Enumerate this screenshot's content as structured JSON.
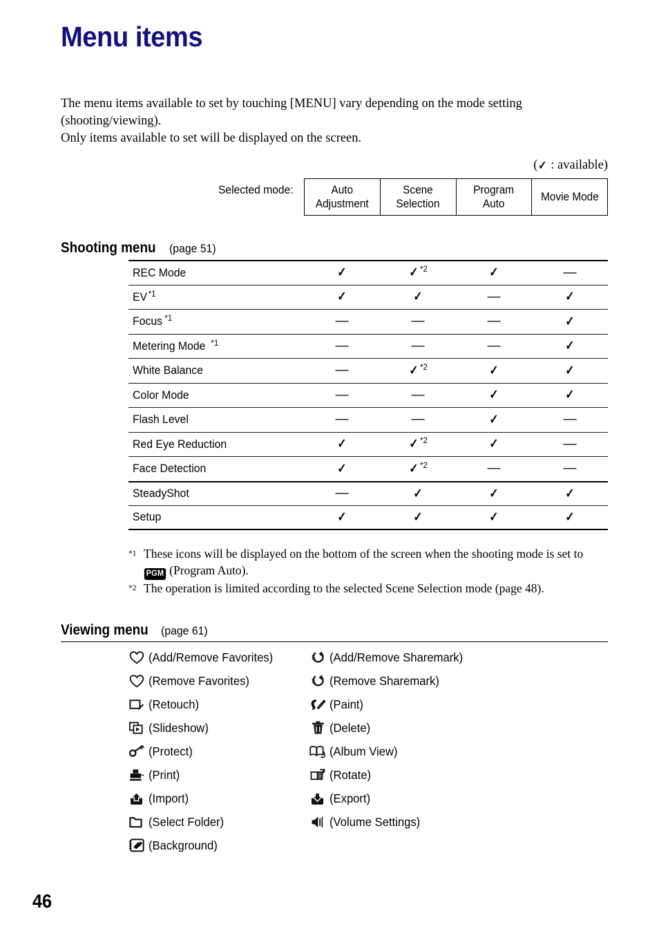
{
  "page": {
    "title": "Menu items",
    "title_color": "#11117f",
    "number": "46"
  },
  "intro": {
    "line1": "The menu items available to set by touching [MENU] vary depending on the mode setting (shooting/viewing).",
    "line2": "Only items available to set will be displayed on the screen."
  },
  "legend": {
    "open": "(",
    "check": "✓",
    "text": ": available)"
  },
  "mode_header": {
    "label": "Selected mode:",
    "columns": [
      "Auto\nAdjustment",
      "Scene\nSelection",
      "Program\nAuto",
      "Movie Mode"
    ]
  },
  "shooting_menu": {
    "heading": "Shooting menu",
    "page_ref": "(page 51)",
    "rows": [
      {
        "name": "REC Mode",
        "sup": "",
        "cells": [
          {
            "type": "check",
            "note": ""
          },
          {
            "type": "check",
            "note": "*2"
          },
          {
            "type": "check",
            "note": ""
          },
          {
            "type": "dash",
            "note": ""
          }
        ]
      },
      {
        "name": "EV",
        "sup": "*1",
        "cells": [
          {
            "type": "check",
            "note": ""
          },
          {
            "type": "check",
            "note": ""
          },
          {
            "type": "dash",
            "note": ""
          },
          {
            "type": "check",
            "note": ""
          }
        ]
      },
      {
        "name": "Focus",
        "sup": "*1",
        "cells": [
          {
            "type": "dash",
            "note": ""
          },
          {
            "type": "dash",
            "note": ""
          },
          {
            "type": "dash",
            "note": ""
          },
          {
            "type": "check",
            "note": ""
          }
        ]
      },
      {
        "name": "Metering Mode",
        "sup": "*1",
        "cells": [
          {
            "type": "dash",
            "note": ""
          },
          {
            "type": "dash",
            "note": ""
          },
          {
            "type": "dash",
            "note": ""
          },
          {
            "type": "check",
            "note": ""
          }
        ]
      },
      {
        "name": "White Balance",
        "sup": "",
        "cells": [
          {
            "type": "dash",
            "note": ""
          },
          {
            "type": "check",
            "note": "*2"
          },
          {
            "type": "check",
            "note": ""
          },
          {
            "type": "check",
            "note": ""
          }
        ]
      },
      {
        "name": "Color Mode",
        "sup": "",
        "cells": [
          {
            "type": "dash",
            "note": ""
          },
          {
            "type": "dash",
            "note": ""
          },
          {
            "type": "check",
            "note": ""
          },
          {
            "type": "check",
            "note": ""
          }
        ]
      },
      {
        "name": "Flash Level",
        "sup": "",
        "cells": [
          {
            "type": "dash",
            "note": ""
          },
          {
            "type": "dash",
            "note": ""
          },
          {
            "type": "check",
            "note": ""
          },
          {
            "type": "dash",
            "note": ""
          }
        ]
      },
      {
        "name": "Red Eye Reduction",
        "sup": "",
        "cells": [
          {
            "type": "check",
            "note": ""
          },
          {
            "type": "check",
            "note": "*2"
          },
          {
            "type": "check",
            "note": ""
          },
          {
            "type": "dash",
            "note": ""
          }
        ]
      },
      {
        "name": "Face Detection",
        "sup": "",
        "cells": [
          {
            "type": "check",
            "note": ""
          },
          {
            "type": "check",
            "note": "*2"
          },
          {
            "type": "dash",
            "note": ""
          },
          {
            "type": "dash",
            "note": ""
          }
        ]
      },
      {
        "name": "SteadyShot",
        "sup": "",
        "cells": [
          {
            "type": "dash",
            "note": ""
          },
          {
            "type": "check",
            "note": ""
          },
          {
            "type": "check",
            "note": ""
          },
          {
            "type": "check",
            "note": ""
          }
        ]
      },
      {
        "name": "Setup",
        "sup": "",
        "cells": [
          {
            "type": "check",
            "note": ""
          },
          {
            "type": "check",
            "note": ""
          },
          {
            "type": "check",
            "note": ""
          },
          {
            "type": "check",
            "note": ""
          }
        ]
      }
    ]
  },
  "footnotes": {
    "note1_mark": "*1",
    "note1_part1": "These icons will be displayed on the bottom of the screen when the shooting mode is set to",
    "note1_badge": "PGM",
    "note1_part2": "(Program Auto).",
    "note2_mark": "*2",
    "note2_text": "The operation is limited according to the selected Scene Selection mode (page 48)."
  },
  "viewing_menu": {
    "heading": "Viewing menu",
    "page_ref": "(page 61)",
    "rows": [
      [
        {
          "icon": "heart-outline-icon",
          "label": "(Add/Remove Favorites)"
        },
        {
          "icon": "sharemark-icon",
          "label": "(Add/Remove Sharemark)"
        }
      ],
      [
        {
          "icon": "heart-outline-icon",
          "label": "(Remove Favorites)"
        },
        {
          "icon": "sharemark-icon",
          "label": "(Remove Sharemark)"
        }
      ],
      [
        {
          "icon": "retouch-icon",
          "label": "(Retouch)"
        },
        {
          "icon": "paint-icon",
          "label": "(Paint)"
        }
      ],
      [
        {
          "icon": "slideshow-icon",
          "label": "(Slideshow)"
        },
        {
          "icon": "trash-icon",
          "label": "(Delete)"
        }
      ],
      [
        {
          "icon": "key-icon",
          "label": "(Protect)"
        },
        {
          "icon": "album-book-icon",
          "label": "(Album View)"
        }
      ],
      [
        {
          "icon": "printer-icon",
          "label": "(Print)"
        },
        {
          "icon": "rotate-icon",
          "label": "(Rotate)"
        }
      ],
      [
        {
          "icon": "import-icon",
          "label": "(Import)"
        },
        {
          "icon": "export-icon",
          "label": "(Export)"
        }
      ],
      [
        {
          "icon": "folder-icon",
          "label": "(Select Folder)"
        },
        {
          "icon": "speaker-icon",
          "label": "(Volume Settings)"
        }
      ],
      [
        {
          "icon": "background-icon",
          "label": "(Background)"
        },
        null
      ]
    ]
  }
}
